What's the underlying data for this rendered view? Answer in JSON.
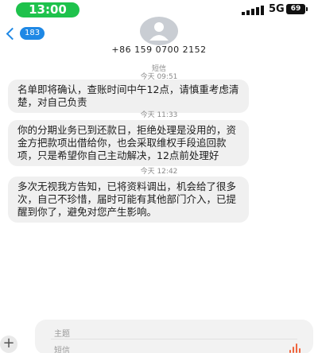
{
  "status_bar": {
    "time": "13:00",
    "network": "5G",
    "battery": "69"
  },
  "header": {
    "back_count": "183",
    "phone_number": "+86 159 0700 2152"
  },
  "conversation": {
    "channel": "短信",
    "messages": [
      {
        "time": "今天 09:51",
        "text": "名单即将确认，查账时间中午12点，请慎重考虑清楚，对自己负责"
      },
      {
        "time": "今天 11:33",
        "text": "你的分期业务已到还款日，拒绝处理是没用的，资金方把款项出借给你，也会采取维权手段追回款项，只是希望你自己主动解决，12点前处理好"
      },
      {
        "time": "今天 12:42",
        "text": "多次无视我方告知，已将资料调出，机会给了很多次，自己不珍惜，届时可能有其他部门介入，已提醒到你了，避免对您产生影响。"
      }
    ]
  },
  "compose": {
    "subject_placeholder": "主题",
    "message_placeholder": "短信",
    "add_label": "+"
  },
  "colors": {
    "status_green": "#1ec24c",
    "accent_blue": "#1e88e5",
    "bubble_bg": "#f0f0f0",
    "voice_orange": "#f0643c"
  }
}
